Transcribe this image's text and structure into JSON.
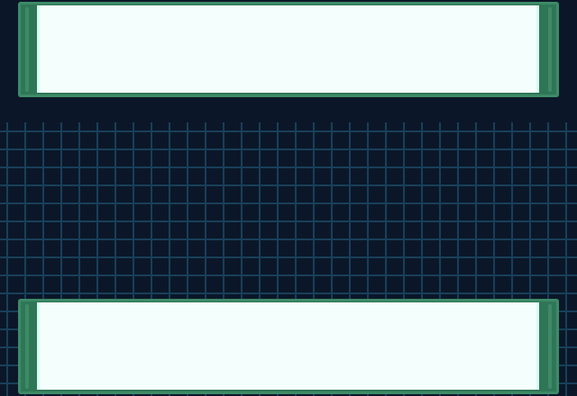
{
  "scene": {
    "colors": {
      "background": "#0b1728",
      "grid_line": "#183f5a",
      "panel_frame": "#2f7657",
      "panel_frame_inner": "#3d8a67",
      "panel_fill": "#f4fffd",
      "panel_edge_highlight": "#d8fbf1"
    }
  },
  "top_panel": {
    "text": ""
  },
  "bottom_panel": {
    "text": ""
  }
}
